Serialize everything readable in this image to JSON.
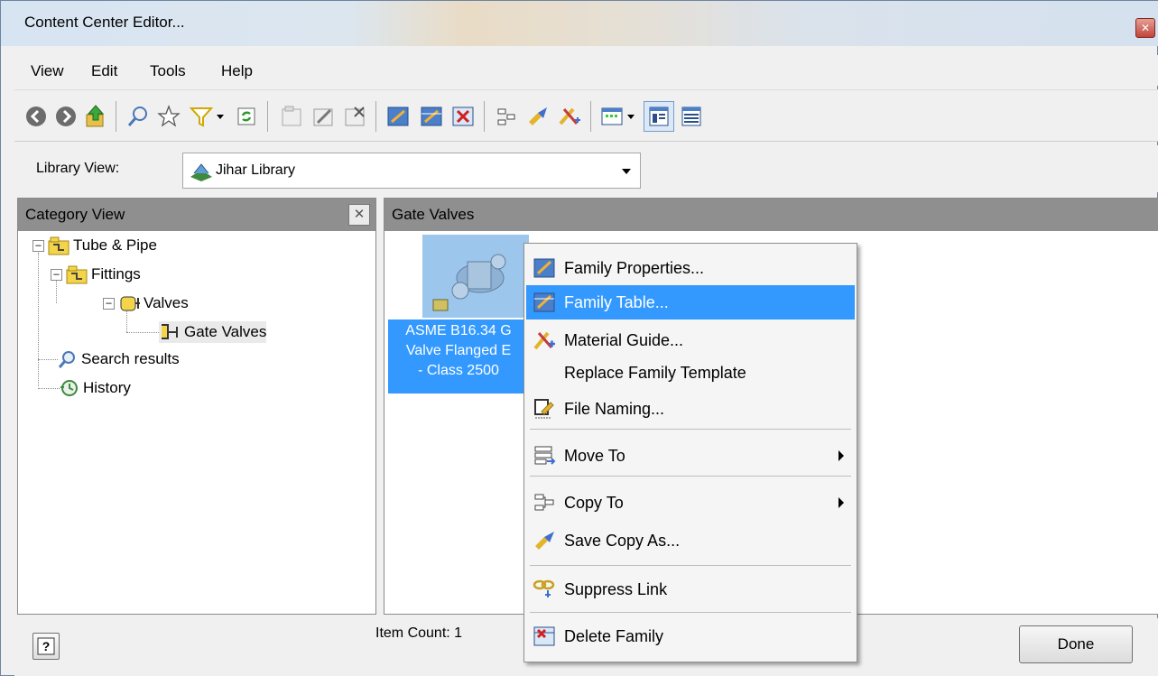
{
  "window": {
    "title": "Content Center Editor..."
  },
  "menu": [
    "View",
    "Edit",
    "Tools",
    "Help"
  ],
  "library": {
    "label": "Library View:",
    "value": "Jihar Library"
  },
  "category_panel": {
    "header": "Category View",
    "tree": {
      "tube_pipe": "Tube & Pipe",
      "fittings": "Fittings",
      "valves": "Valves",
      "gate_valves": "Gate Valves",
      "search_results": "Search results",
      "history": "History"
    }
  },
  "content_panel": {
    "header": "Gate Valves",
    "family_label_lines": [
      "ASME B16.34 G",
      "Valve Flanged E",
      "- Class 2500"
    ]
  },
  "context_menu": {
    "family_properties": "Family Properties...",
    "family_table": "Family Table...",
    "material_guide": "Material Guide...",
    "replace_family_template": "Replace Family Template",
    "file_naming": "File Naming...",
    "move_to": "Move To",
    "copy_to": "Copy To",
    "save_copy_as": "Save Copy As...",
    "suppress_link": "Suppress Link",
    "delete_family": "Delete Family"
  },
  "status": {
    "item_count": "Item Count: 1",
    "done": "Done"
  },
  "colors": {
    "selection": "#3399ff",
    "header_gray": "#8f8f8f"
  }
}
